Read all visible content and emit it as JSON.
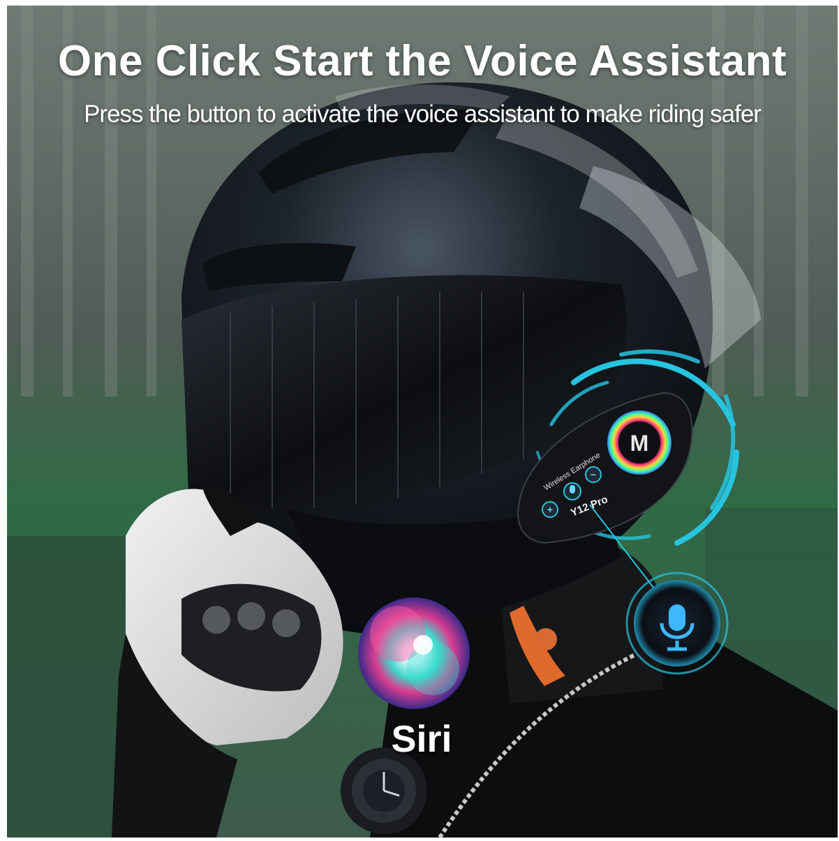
{
  "headline": "One Click Start the Voice Assistant",
  "subheadline": "Press the button to activate the voice assistant to make riding safer",
  "siri_label": "Siri",
  "device": {
    "brand_text": "Wireless Earphone",
    "model_text": "Y12 Pro",
    "plus_symbol": "+",
    "minus_symbol": "−"
  },
  "icons": {
    "microphone": "microphone-icon",
    "siri": "siri-orb-icon"
  },
  "colors": {
    "accent_cyan": "#27c4e0",
    "helmet": "#15181c",
    "background_green": "#2f6a45"
  }
}
